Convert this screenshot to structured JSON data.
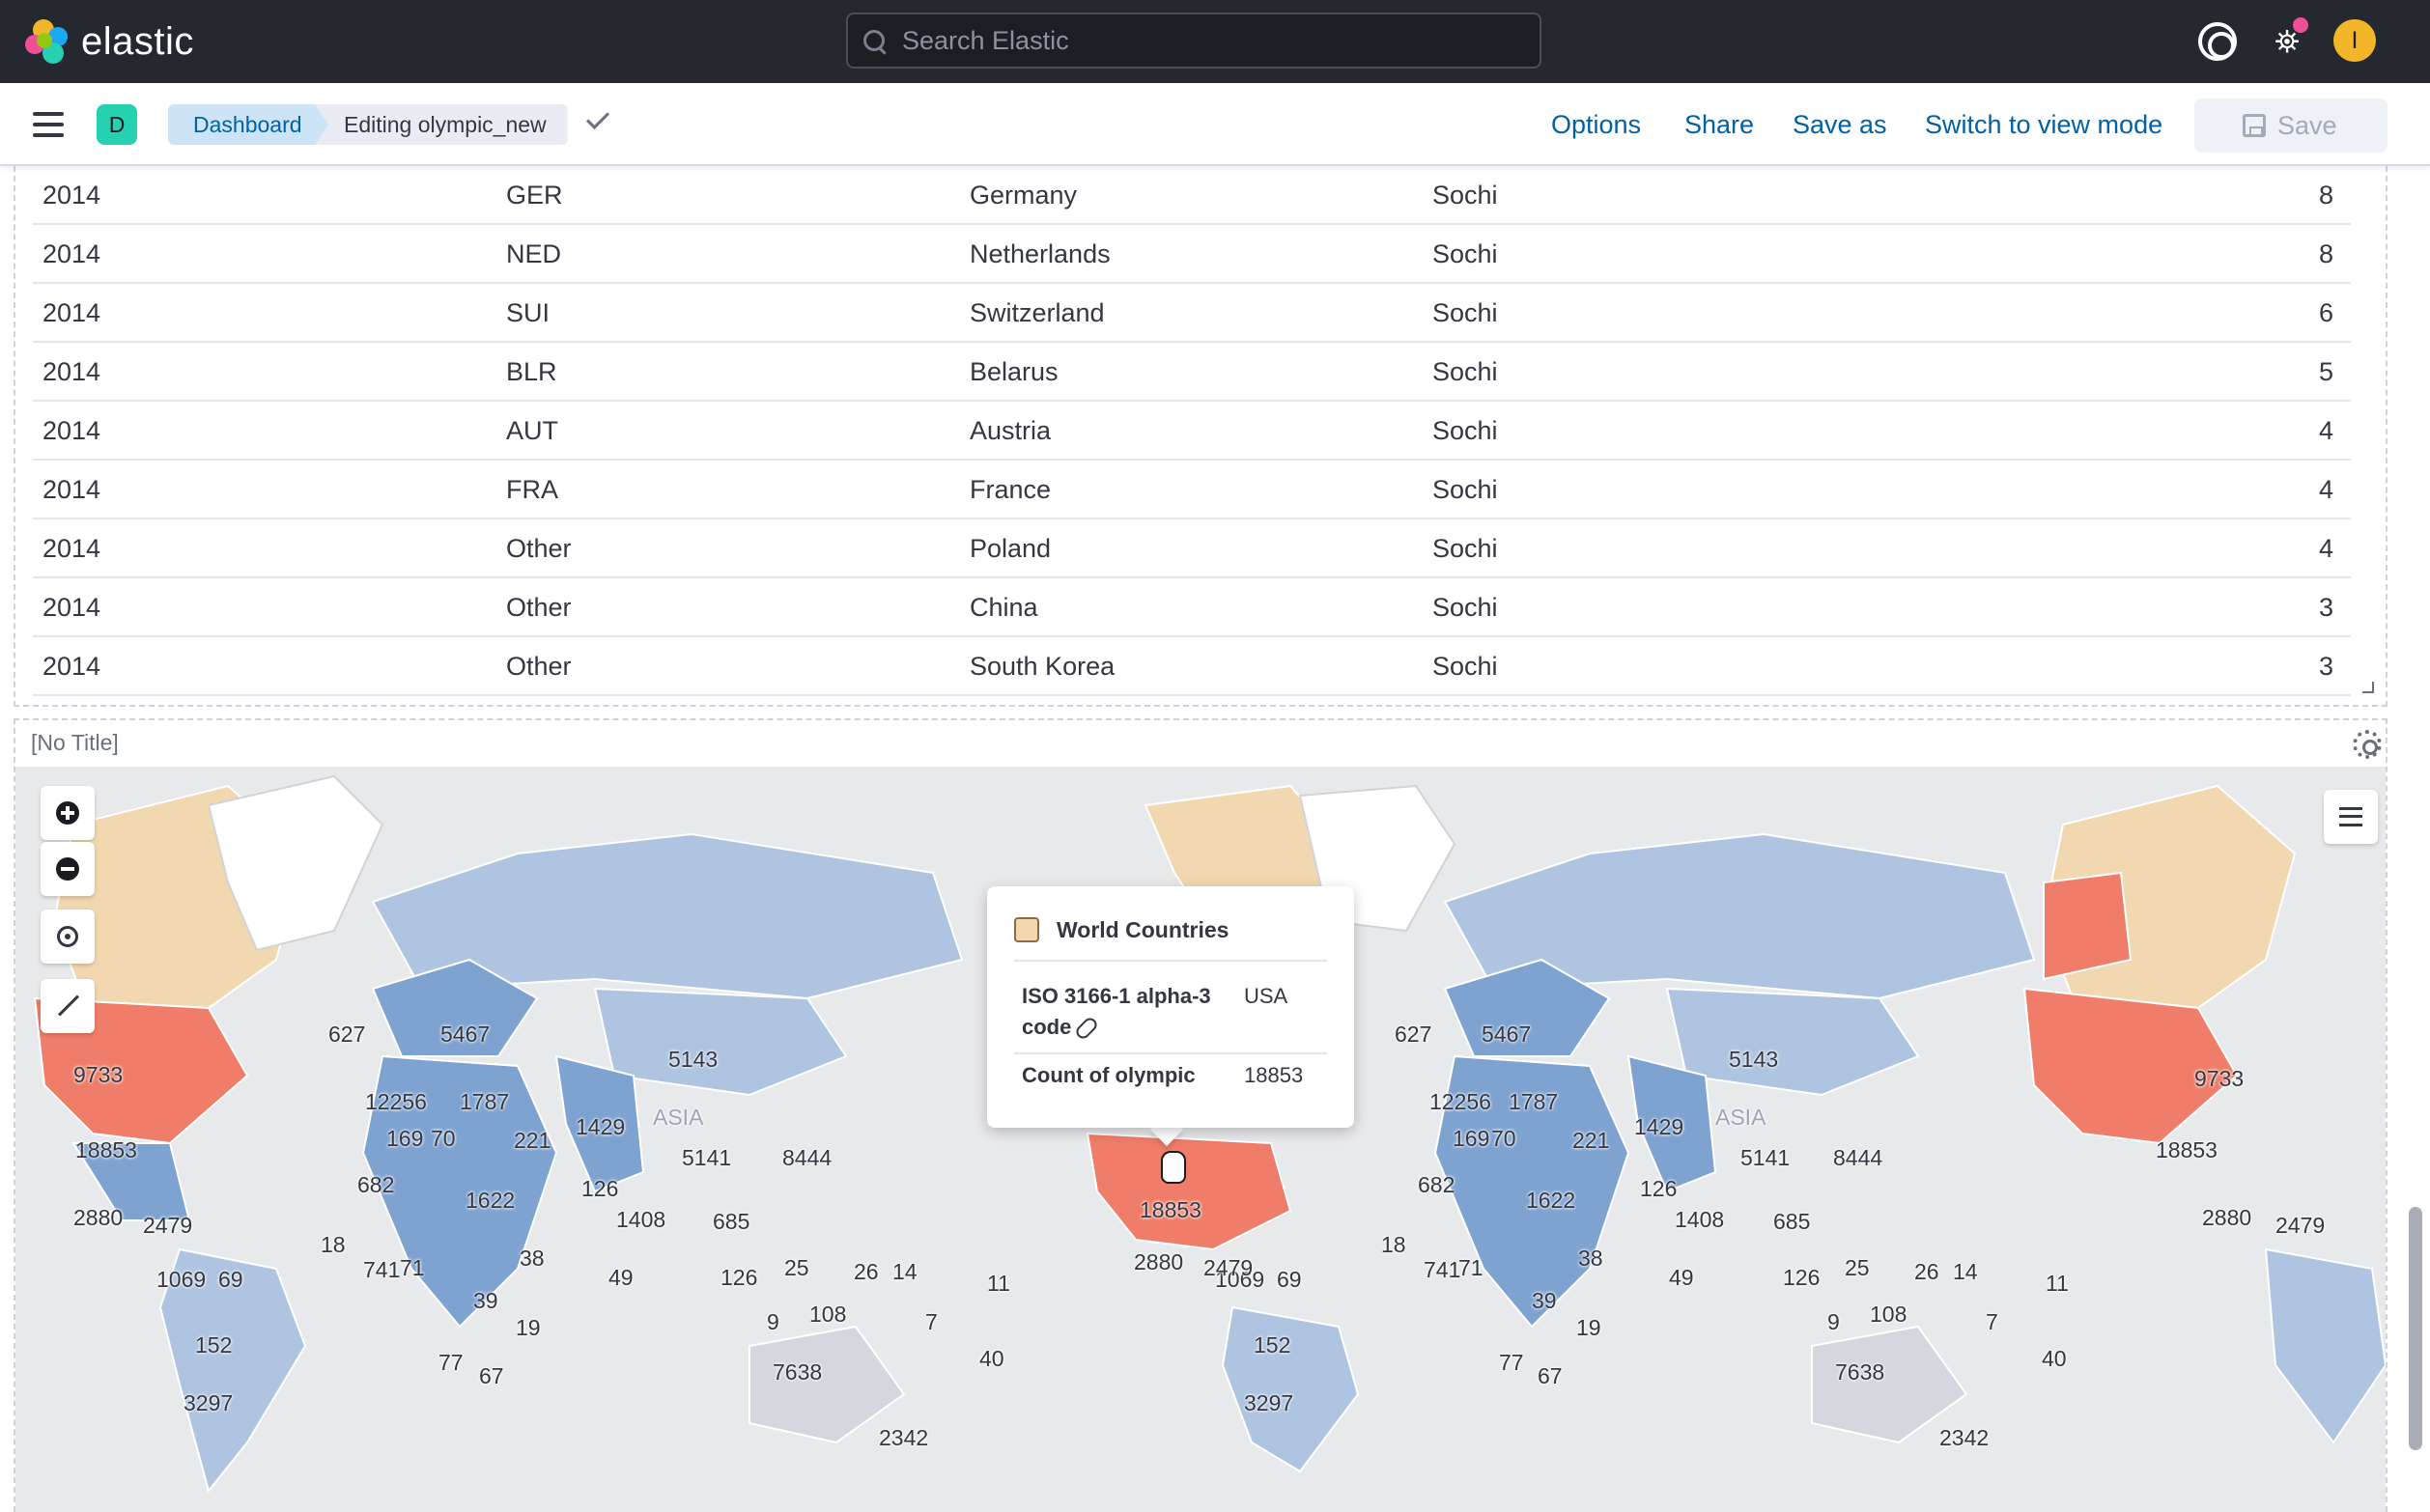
{
  "header": {
    "logo_text": "elastic",
    "search_placeholder": "Search Elastic",
    "help_icon": "help-icon",
    "news_icon": "newsfeed-icon",
    "avatar_initial": "I",
    "colors": {
      "background": "#25282f",
      "avatar": "#f2b628",
      "news_badge": "#f04e98"
    }
  },
  "nav": {
    "space_initial": "D",
    "breadcrumbs": [
      "Dashboard",
      "Editing olympic_new"
    ],
    "actions": {
      "options": "Options",
      "share": "Share",
      "save_as": "Save as",
      "view_mode": "Switch to view mode",
      "save": "Save"
    },
    "colors": {
      "link": "#0061a6",
      "space": "#25d1b0"
    }
  },
  "table": {
    "rows": [
      [
        "2014",
        "GER",
        "Germany",
        "Sochi",
        "8"
      ],
      [
        "2014",
        "NED",
        "Netherlands",
        "Sochi",
        "8"
      ],
      [
        "2014",
        "SUI",
        "Switzerland",
        "Sochi",
        "6"
      ],
      [
        "2014",
        "BLR",
        "Belarus",
        "Sochi",
        "5"
      ],
      [
        "2014",
        "AUT",
        "Austria",
        "Sochi",
        "4"
      ],
      [
        "2014",
        "FRA",
        "France",
        "Sochi",
        "4"
      ],
      [
        "2014",
        "Other",
        "Poland",
        "Sochi",
        "4"
      ],
      [
        "2014",
        "Other",
        "China",
        "Sochi",
        "3"
      ],
      [
        "2014",
        "Other",
        "South Korea",
        "Sochi",
        "3"
      ]
    ]
  },
  "map_panel": {
    "title": "[No Title]",
    "labels": [
      "627",
      "5467",
      "5143",
      "9733",
      "12256",
      "1787",
      "1429",
      "5141",
      "8444",
      "18853",
      "169",
      "70",
      "221",
      "682",
      "126",
      "1622",
      "1408",
      "685",
      "2880",
      "2479",
      "18",
      "741",
      "71",
      "38",
      "49",
      "126",
      "25",
      "26",
      "14",
      "11",
      "1069",
      "69",
      "39",
      "19",
      "9",
      "108",
      "7",
      "152",
      "77",
      "67",
      "7638",
      "40",
      "3297",
      "2342"
    ],
    "watermark": "ASIA",
    "colors": {
      "high": "#ef7d69",
      "mid": "#f2d8b1",
      "low": "#aec4e0",
      "lower": "#7fa3d1",
      "none": "#ffffff",
      "water": "#e8e9eb"
    }
  },
  "tooltip": {
    "layer": "World Countries",
    "field1_key": "ISO 3166-1 alpha-3 code",
    "field1_value": "USA",
    "field2_key": "Count of olympic",
    "field2_value": "18853"
  }
}
